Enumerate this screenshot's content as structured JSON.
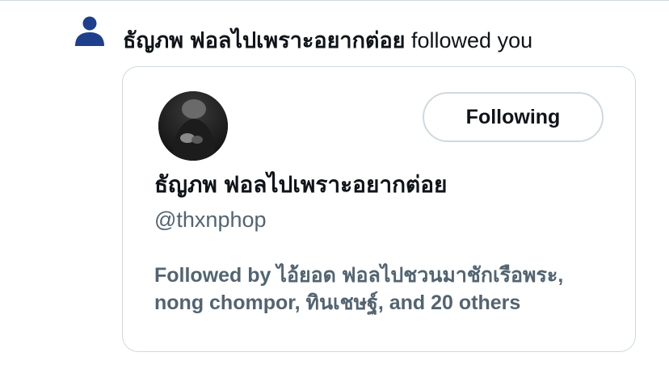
{
  "notification": {
    "icon": "person-icon",
    "follower_name": "ธัญภพ ฟอลไปเพราะอยากต่อย",
    "action_text": "followed you",
    "icon_color": "#1d3f8c"
  },
  "profile_card": {
    "display_name": "ธัญภพ ฟอลไปเพราะอยากต่อย",
    "handle": "@thxnphop",
    "follow_button_label": "Following",
    "followed_by_line1": "Followed by ไอ้ยอด ฟอลไปชวนมาชักเรือพระ,",
    "followed_by_line2": "nong chompor, ทินเชษฐ์, and 20 others"
  },
  "colors": {
    "text_primary": "#0f1419",
    "text_secondary": "#536471",
    "border": "#cfd9de"
  }
}
